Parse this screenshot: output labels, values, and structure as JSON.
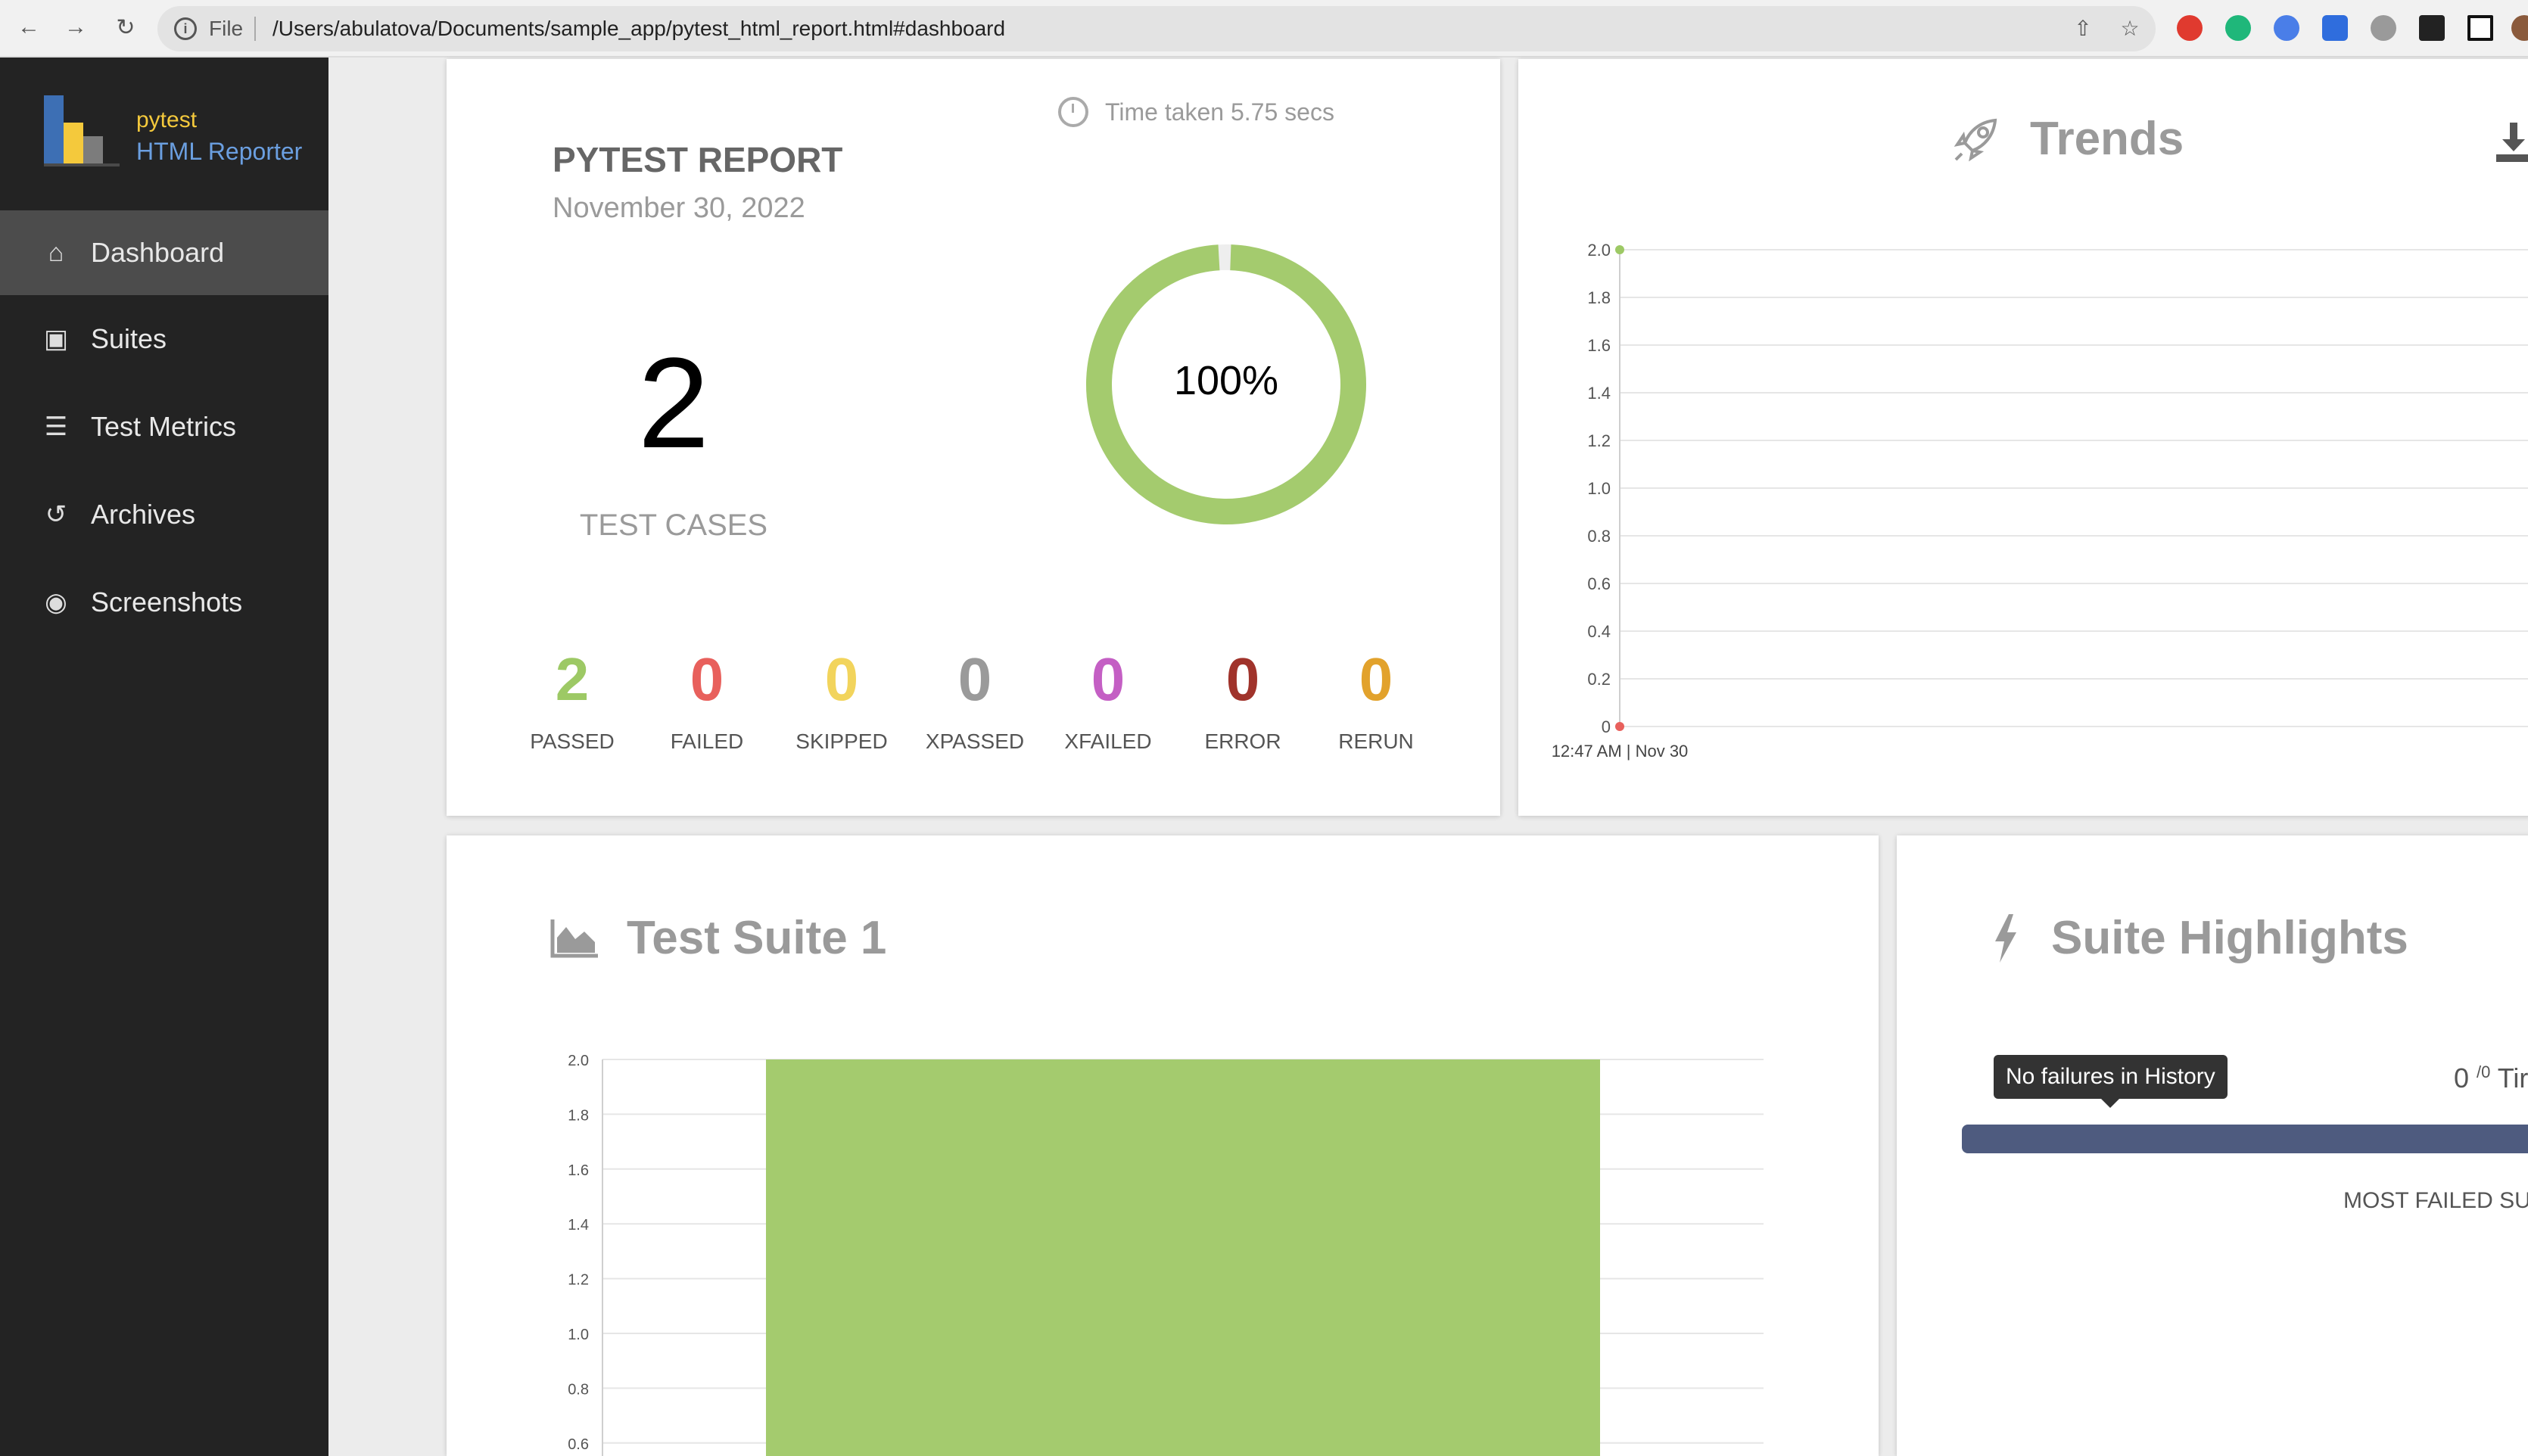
{
  "browser": {
    "file_label": "File",
    "url": "/Users/abulatova/Documents/sample_app/pytest_html_report.html#dashboard"
  },
  "sidebar": {
    "brand_line1": "pytest",
    "brand_line2": "HTML Reporter",
    "items": [
      {
        "label": "Dashboard",
        "icon": "home-icon",
        "active": true
      },
      {
        "label": "Suites",
        "icon": "briefcase-icon"
      },
      {
        "label": "Test Metrics",
        "icon": "server-icon"
      },
      {
        "label": "Archives",
        "icon": "history-icon"
      },
      {
        "label": "Screenshots",
        "icon": "camera-icon"
      }
    ]
  },
  "report": {
    "time_taken": "Time taken 5.75 secs",
    "title": "PYTEST REPORT",
    "date": "November 30, 2022",
    "total": "2",
    "total_label": "TEST CASES",
    "pass_percent": "100%",
    "pass_fraction": 1.0,
    "stats": [
      {
        "value": "2",
        "label": "PASSED",
        "color": "#9dc965"
      },
      {
        "value": "0",
        "label": "FAILED",
        "color": "#e8605c"
      },
      {
        "value": "0",
        "label": "SKIPPED",
        "color": "#f2d45c"
      },
      {
        "value": "0",
        "label": "XPASSED",
        "color": "#9a9a9a"
      },
      {
        "value": "0",
        "label": "XFAILED",
        "color": "#c45fc4"
      },
      {
        "value": "0",
        "label": "ERROR",
        "color": "#a0332b"
      },
      {
        "value": "0",
        "label": "RERUN",
        "color": "#e2a22c"
      }
    ]
  },
  "trends": {
    "title": "Trends"
  },
  "suite": {
    "title": "Test Suite 1"
  },
  "highlights": {
    "title": "Suite Highlights",
    "tooltip": "No failures in History",
    "ratio_num": "0",
    "ratio_den": "/0",
    "ratio_suffix": "Tir",
    "most_failed": "MOST FAILED SU"
  },
  "chart_data": [
    {
      "type": "line",
      "x": [
        "12:47 AM | Nov 30"
      ],
      "series": [
        {
          "values": [
            2
          ],
          "color": "#9dc965"
        },
        {
          "values": [
            0
          ],
          "color": "#e8605c"
        }
      ],
      "ylim": [
        0,
        2.0
      ],
      "yticks": [
        "0",
        "0.2",
        "0.4",
        "0.6",
        "0.8",
        "1.0",
        "1.2",
        "1.4",
        "1.6",
        "1.8",
        "2.0"
      ],
      "grid": true
    },
    {
      "type": "bar",
      "values": [
        2
      ],
      "color": "#a4cb6e",
      "ylim": [
        0,
        2.0
      ],
      "yticks": [
        "0.6",
        "0.8",
        "1.0",
        "1.2",
        "1.4",
        "1.6",
        "1.8",
        "2.0"
      ],
      "grid": true
    }
  ]
}
